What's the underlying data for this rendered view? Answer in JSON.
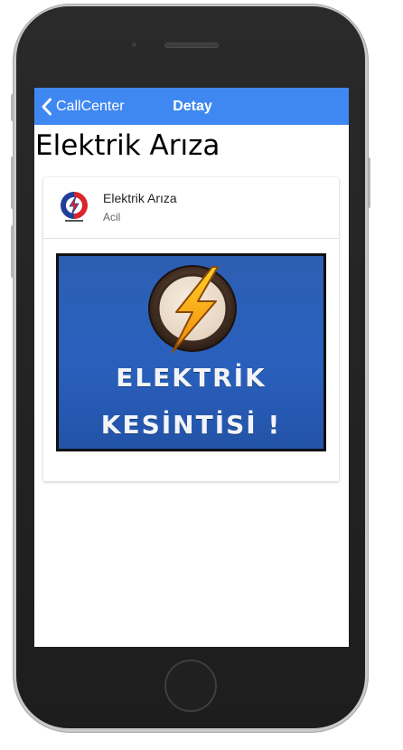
{
  "navbar": {
    "back_label": "CallCenter",
    "title": "Detay",
    "color": "#3f88f2"
  },
  "page": {
    "title": "Elektrik Arıza"
  },
  "card": {
    "avatar_icon": "electric-company-logo",
    "item_title": "Elektrik Arıza",
    "item_subtitle": "Acil",
    "banner": {
      "icon": "lightning-bolt-icon",
      "line1": "ELEKTRİK",
      "line2": "KESİNTİSİ !"
    }
  }
}
